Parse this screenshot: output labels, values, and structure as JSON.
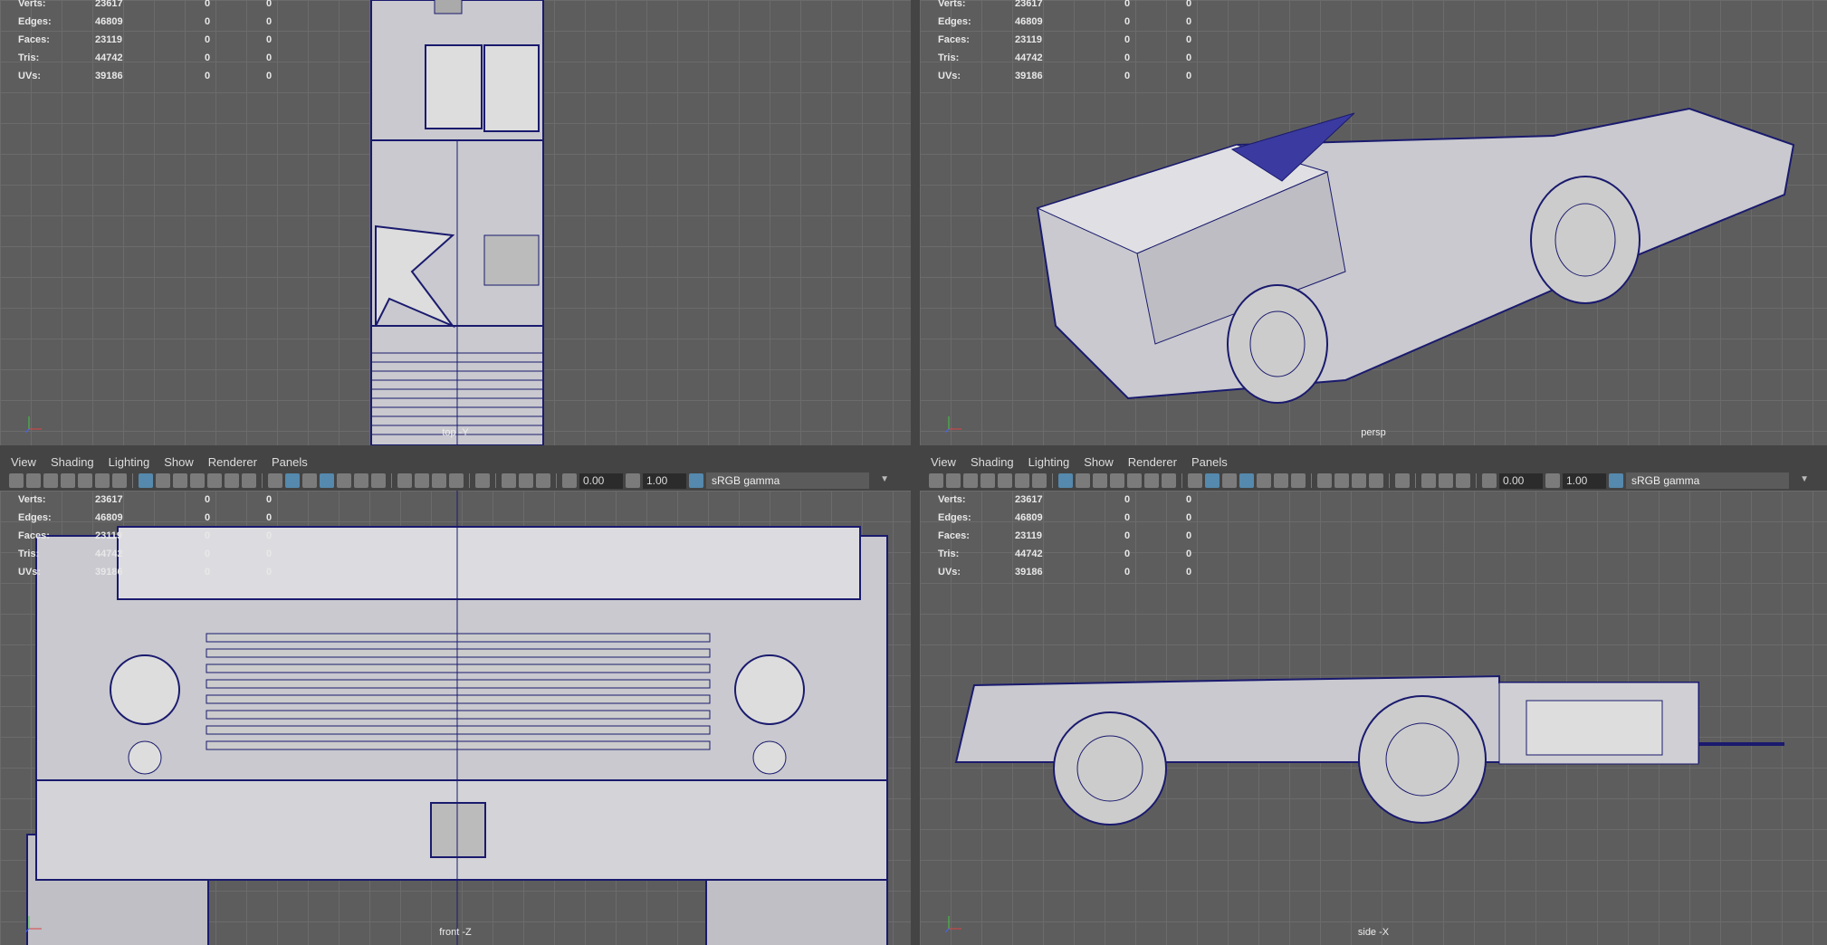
{
  "menu": [
    "View",
    "Shading",
    "Lighting",
    "Show",
    "Renderer",
    "Panels"
  ],
  "toolbar": {
    "icons": [
      "camera-icon",
      "camera-lock-icon",
      "camera-attr-icon",
      "bookmark-icon",
      "image-plane-icon",
      "2d-pan-icon",
      "grease-pencil-icon",
      "|",
      "grid-icon",
      "film-gate-icon",
      "resolution-gate-icon",
      "gate-mask-icon",
      "field-chart-icon",
      "safe-action-icon",
      "safe-title-icon",
      "|",
      "wireframe-icon",
      "smooth-shade-icon",
      "default-material-icon",
      "wireframe-on-shaded-icon",
      "xray-icon",
      "lights-icon",
      "shadows-icon",
      "|",
      "screen-ao-icon",
      "motion-blur-icon",
      "antialias-icon",
      "dof-icon",
      "|",
      "isolate-select-icon",
      "|",
      "xray-joints-icon",
      "xray-active-icon",
      "backface-icon",
      "|",
      "exposure-icon"
    ],
    "exposure": "0.00",
    "gamma_value": "1.00",
    "color_space": "sRGB gamma"
  },
  "stats": [
    {
      "label": "Verts:",
      "value": "23617",
      "a": "0",
      "b": "0"
    },
    {
      "label": "Edges:",
      "value": "46809",
      "a": "0",
      "b": "0"
    },
    {
      "label": "Faces:",
      "value": "23119",
      "a": "0",
      "b": "0"
    },
    {
      "label": "Tris:",
      "value": "44742",
      "a": "0",
      "b": "0"
    },
    {
      "label": "UVs:",
      "value": "39186",
      "a": "0",
      "b": "0"
    }
  ],
  "viewports": [
    {
      "id": "top",
      "label": "top -Y",
      "menus": false
    },
    {
      "id": "persp",
      "label": "persp",
      "menus": false
    },
    {
      "id": "front",
      "label": "front -Z",
      "menus": true
    },
    {
      "id": "side",
      "label": "side -X",
      "menus": true
    }
  ],
  "colors": {
    "wire": "#1a1a6e",
    "surface": "#c9c9cf",
    "accent": "#5a9bc8"
  }
}
